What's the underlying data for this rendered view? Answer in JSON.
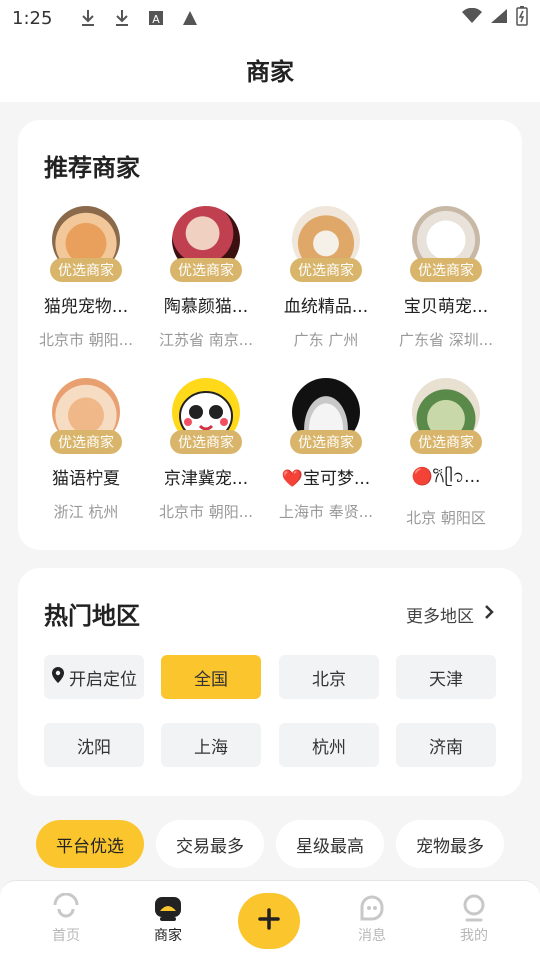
{
  "status": {
    "time": "1:25"
  },
  "header": {
    "title": "商家"
  },
  "recommended": {
    "title": "推荐商家",
    "badge": "优选商家",
    "merchants": [
      {
        "name": "猫兜宠物...",
        "location": "北京市 朝阳..."
      },
      {
        "name": "陶慕颜猫...",
        "location": "江苏省 南京..."
      },
      {
        "name": "血统精品...",
        "location": "广东 广州"
      },
      {
        "name": "宝贝萌宠...",
        "location": "广东省 深圳..."
      },
      {
        "name": "猫语柠夏",
        "location": "浙江 杭州"
      },
      {
        "name": "京津冀宠...",
        "location": "北京市 朝阳..."
      },
      {
        "name": "❤️宝可梦...",
        "location": "上海市 奉贤..."
      },
      {
        "name": "🔴𐙚ᥫ᭡...",
        "location": "北京 朝阳区"
      }
    ]
  },
  "regions": {
    "title": "热门地区",
    "more": "更多地区",
    "locate": "开启定位",
    "items": [
      "全国",
      "北京",
      "天津",
      "沈阳",
      "上海",
      "杭州",
      "济南"
    ],
    "selected": "全国"
  },
  "filters": [
    "平台优选",
    "交易最多",
    "星级最高",
    "宠物最多"
  ],
  "tabbar": {
    "home": "首页",
    "merchants": "商家",
    "messages": "消息",
    "mine": "我的"
  },
  "colors": {
    "accent": "#fbc52d",
    "badge": "#d9b56b"
  }
}
